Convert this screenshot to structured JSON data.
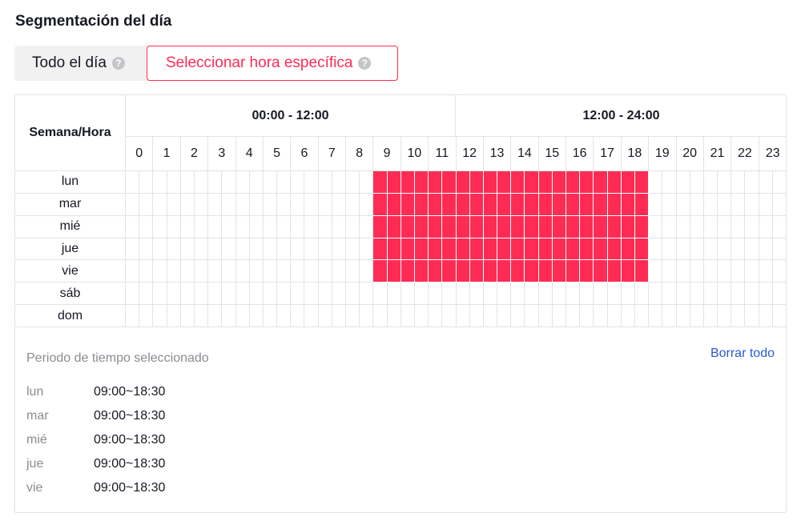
{
  "section_title": "Segmentación del día",
  "tabs": {
    "all_day": "Todo el día",
    "specific": "Seleccionar hora específica",
    "help_glyph": "?"
  },
  "grid": {
    "corner_label": "Semana/Hora",
    "half_labels": [
      "00:00 - 12:00",
      "12:00 - 24:00"
    ],
    "hours": [
      "0",
      "1",
      "2",
      "3",
      "4",
      "5",
      "6",
      "7",
      "8",
      "9",
      "10",
      "11",
      "12",
      "13",
      "14",
      "15",
      "16",
      "17",
      "18",
      "19",
      "20",
      "21",
      "22",
      "23"
    ],
    "days": [
      "lun",
      "mar",
      "mié",
      "jue",
      "vie",
      "sáb",
      "dom"
    ],
    "selected_color": "#fe2c55",
    "selection": [
      {
        "day": "lun",
        "from_half_hour": 18,
        "to_half_hour": 37
      },
      {
        "day": "mar",
        "from_half_hour": 18,
        "to_half_hour": 37
      },
      {
        "day": "mié",
        "from_half_hour": 18,
        "to_half_hour": 37
      },
      {
        "day": "jue",
        "from_half_hour": 18,
        "to_half_hour": 37
      },
      {
        "day": "vie",
        "from_half_hour": 18,
        "to_half_hour": 37
      }
    ]
  },
  "summary": {
    "title": "Periodo de tiempo seleccionado",
    "clear_label": "Borrar todo",
    "rows": [
      {
        "day": "lun",
        "range": "09:00~18:30"
      },
      {
        "day": "mar",
        "range": "09:00~18:30"
      },
      {
        "day": "mié",
        "range": "09:00~18:30"
      },
      {
        "day": "jue",
        "range": "09:00~18:30"
      },
      {
        "day": "vie",
        "range": "09:00~18:30"
      }
    ]
  }
}
